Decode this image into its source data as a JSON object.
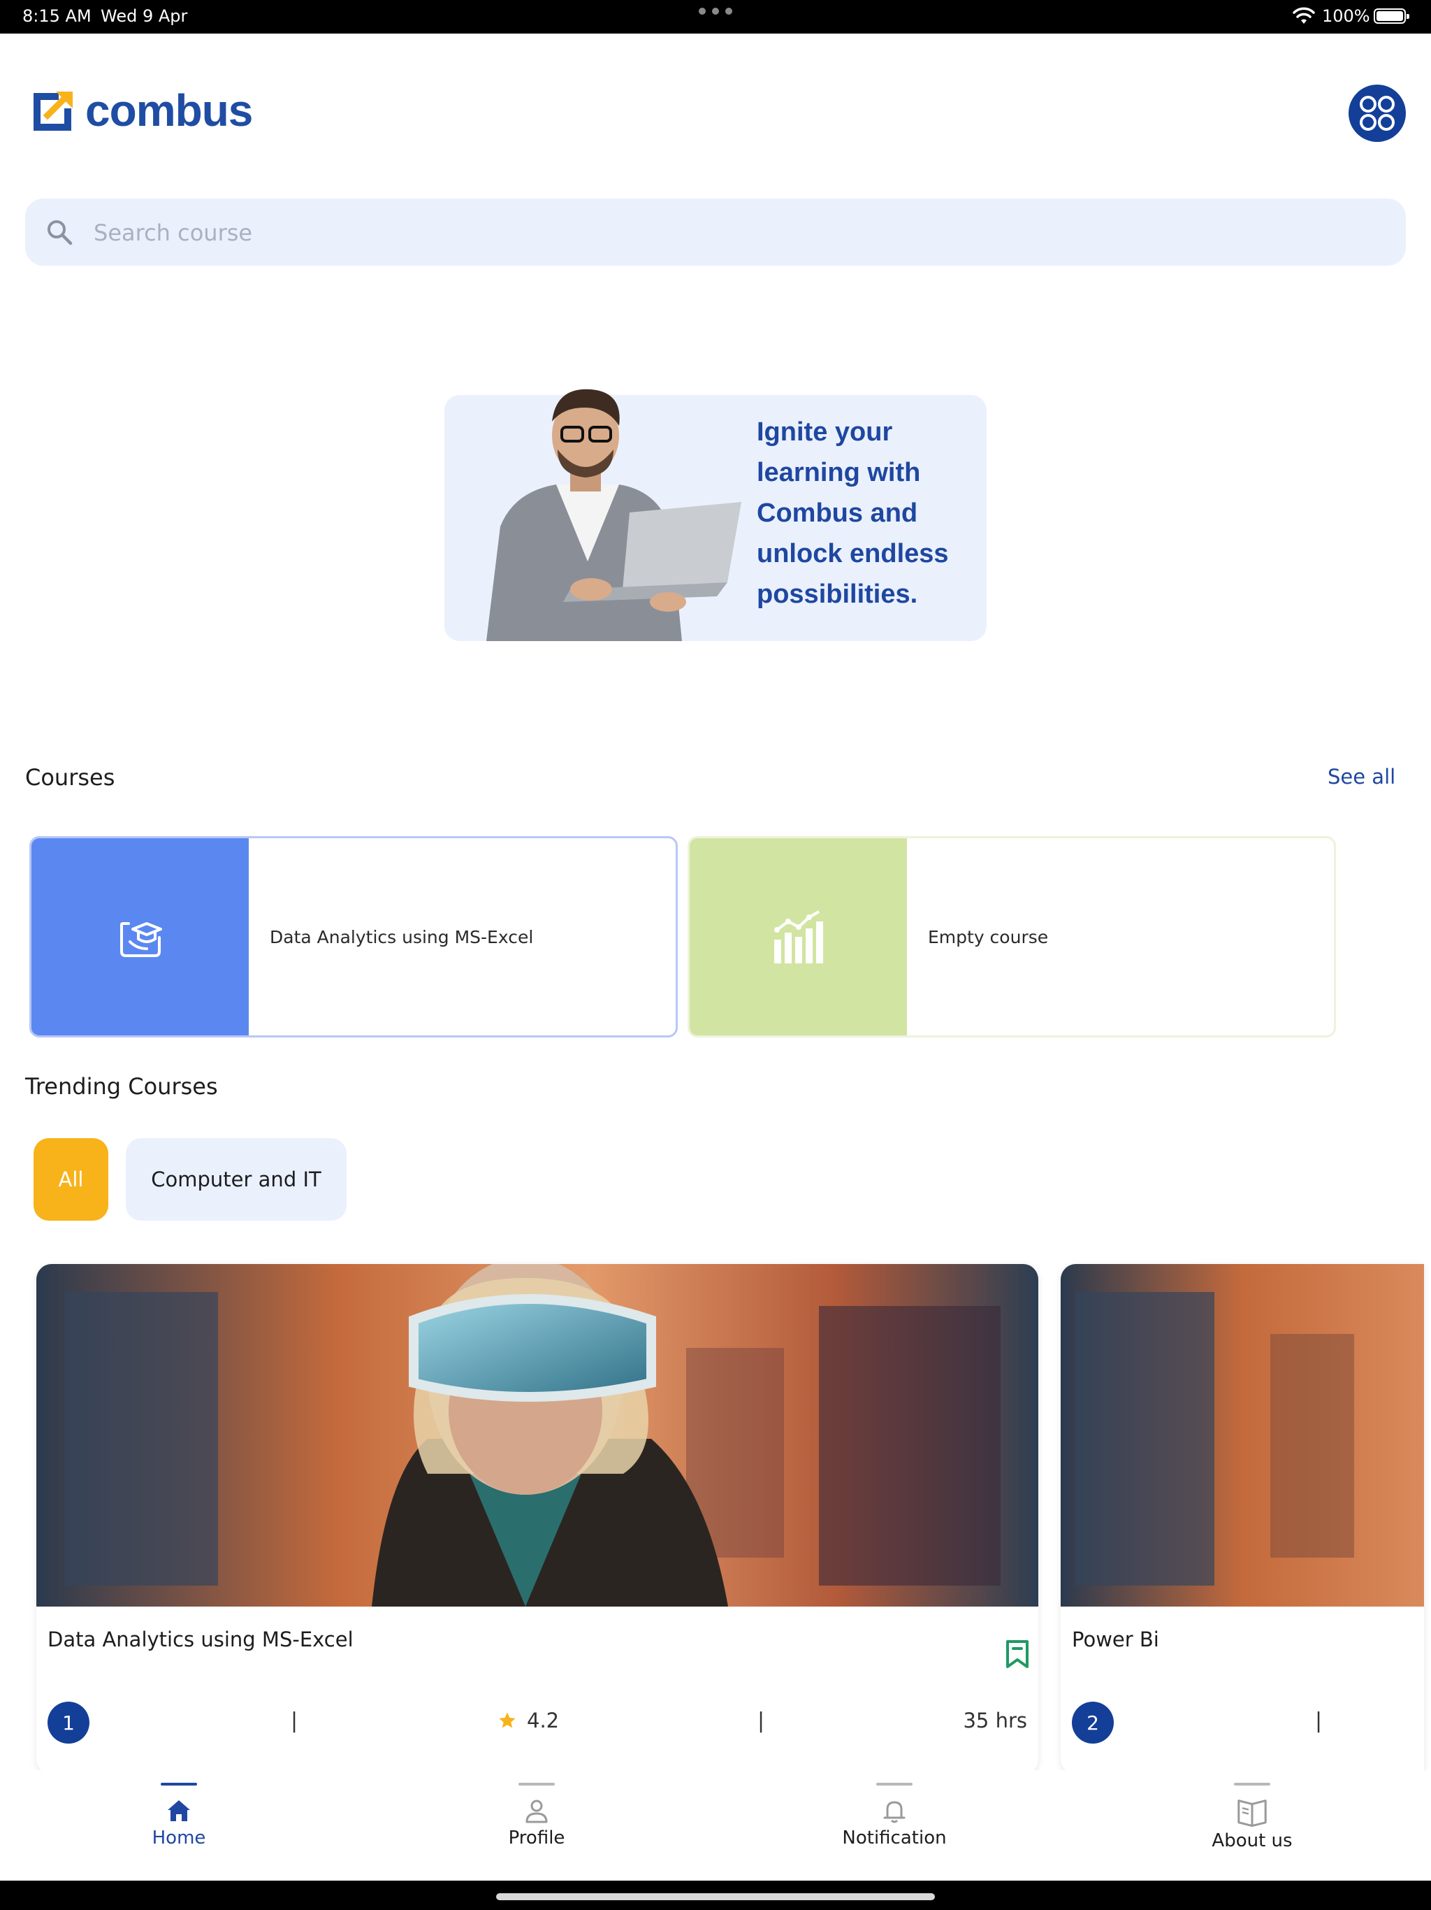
{
  "status_bar": {
    "time": "8:15 AM",
    "date": "Wed 9 Apr",
    "battery": "100%"
  },
  "header": {
    "logo_text": "combus",
    "apps_icon": "grid-circles-icon"
  },
  "search": {
    "placeholder": "Search course",
    "value": ""
  },
  "banner": {
    "text": "Ignite your learning with Combus and unlock endless possibilities."
  },
  "courses": {
    "title": "Courses",
    "see_all": "See all",
    "items": [
      {
        "label": "Data Analytics using MS-Excel",
        "icon": "graduation-cap-icon",
        "color": "#5b88f0"
      },
      {
        "label": "Empty course",
        "icon": "bar-chart-icon",
        "color": "#d2e4a2"
      }
    ]
  },
  "trending": {
    "title": "Trending Courses",
    "filters": [
      {
        "label": "All",
        "active": true
      },
      {
        "label": "Computer and IT",
        "active": false
      }
    ],
    "cards": [
      {
        "title": "Data Analytics using MS-Excel",
        "number": "1",
        "separator": "|",
        "rating": "4.2",
        "duration": "35 hrs"
      },
      {
        "title": "Power Bi",
        "number": "2",
        "separator": "|"
      }
    ]
  },
  "bottom_nav": {
    "items": [
      {
        "label": "Home",
        "icon": "home-icon",
        "active": true
      },
      {
        "label": "Profile",
        "icon": "person-icon",
        "active": false
      },
      {
        "label": "Notification",
        "icon": "bell-icon",
        "active": false
      },
      {
        "label": "About us",
        "icon": "book-icon",
        "active": false
      }
    ]
  },
  "colors": {
    "brand_blue": "#1f47a1",
    "accent_yellow": "#f8b21a",
    "search_bg": "#eaf1fd"
  }
}
